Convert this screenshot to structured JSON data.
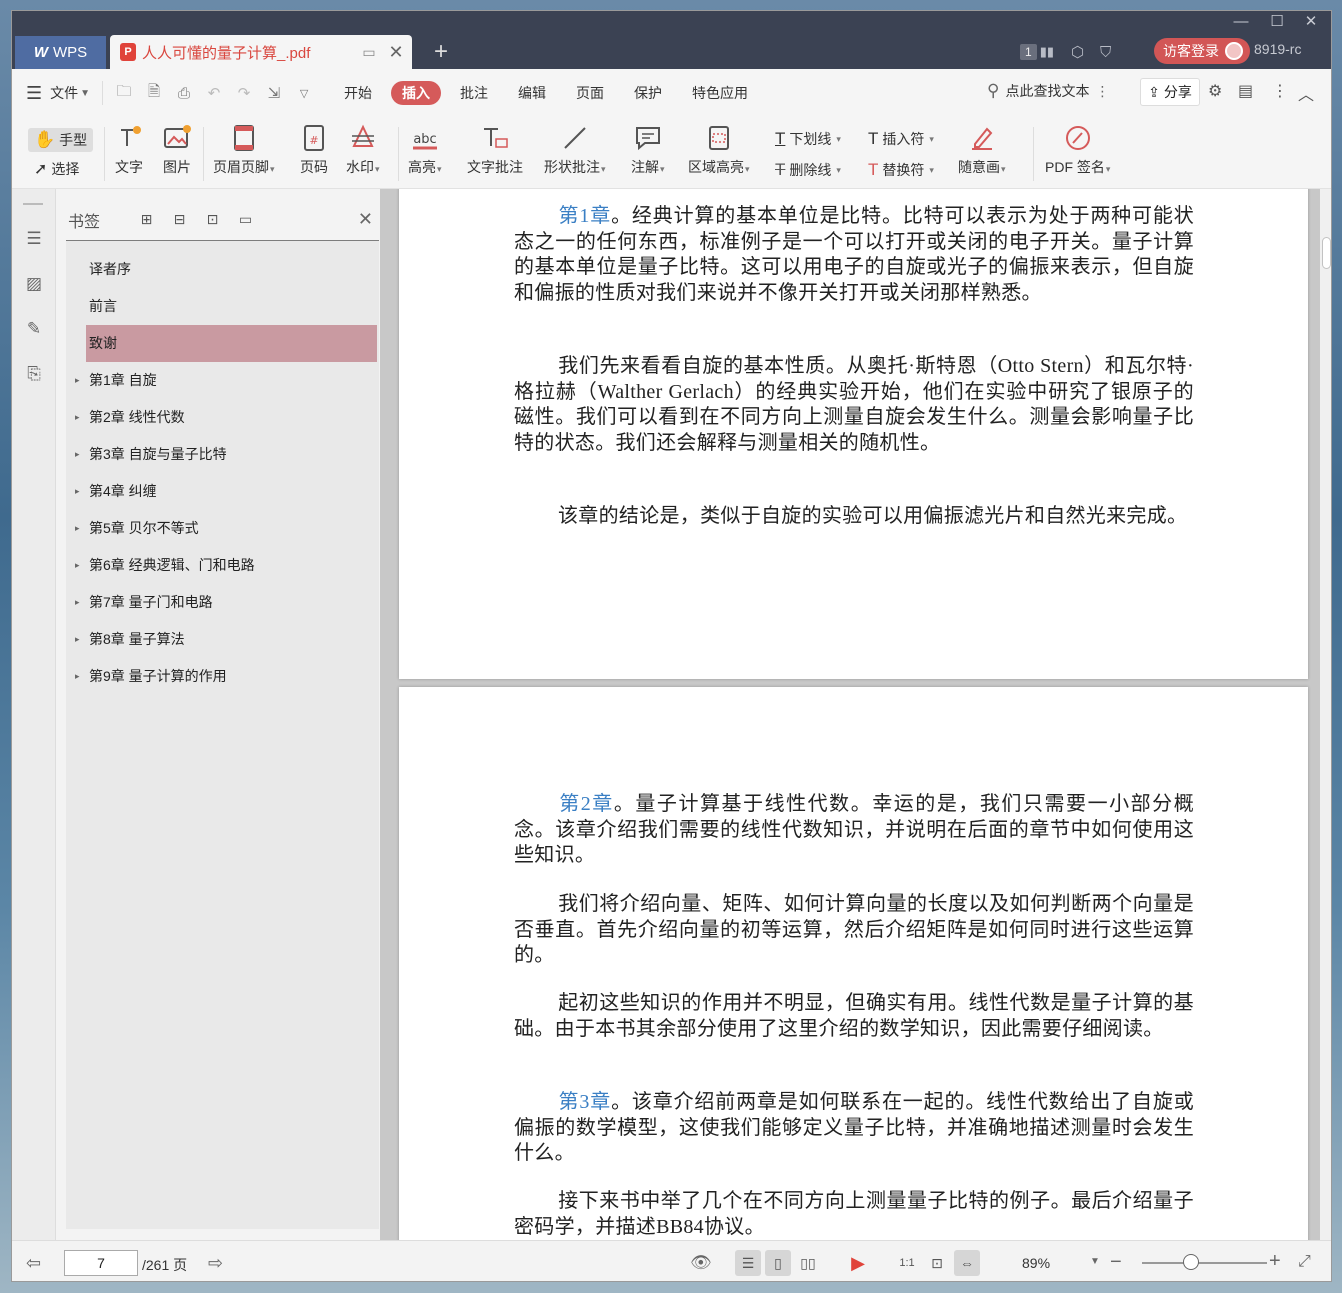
{
  "titlebar": {
    "app_label": "WPS",
    "doc_tab_title": "人人可懂的量子计算_.pdf",
    "page_count_badge": "1",
    "guest_login": "访客登录",
    "user_id": "8919-rc"
  },
  "menu": {
    "file": "文件",
    "items": [
      "开始",
      "插入",
      "批注",
      "编辑",
      "页面",
      "保护",
      "特色应用"
    ],
    "active": "插入",
    "search_label": "点此查找文本",
    "share": "分享"
  },
  "ribbon": {
    "hand": "手型",
    "select": "选择",
    "text": "文字",
    "image": "图片",
    "header_footer": "页眉页脚",
    "page_number": "页码",
    "watermark": "水印",
    "highlight": "高亮",
    "text_note": "文字批注",
    "shape_note": "形状批注",
    "comment": "注解",
    "area_highlight": "区域高亮",
    "underline": "下划线",
    "strikethrough": "删除线",
    "insert_mark": "插入符",
    "replace_mark": "替换符",
    "freehand": "随意画",
    "pdf_sign": "PDF 签名",
    "highlight_icon_text": "abc"
  },
  "bookmarks": {
    "title": "书签",
    "items": [
      {
        "label": "译者序",
        "expandable": false,
        "selected": false
      },
      {
        "label": "前言",
        "expandable": false,
        "selected": false
      },
      {
        "label": "致谢",
        "expandable": false,
        "selected": true
      },
      {
        "label": "第1章 自旋",
        "expandable": true,
        "selected": false
      },
      {
        "label": "第2章 线性代数",
        "expandable": true,
        "selected": false
      },
      {
        "label": "第3章 自旋与量子比特",
        "expandable": true,
        "selected": false
      },
      {
        "label": "第4章 纠缠",
        "expandable": true,
        "selected": false
      },
      {
        "label": "第5章 贝尔不等式",
        "expandable": true,
        "selected": false
      },
      {
        "label": "第6章 经典逻辑、门和电路",
        "expandable": true,
        "selected": false
      },
      {
        "label": "第7章 量子门和电路",
        "expandable": true,
        "selected": false
      },
      {
        "label": "第8章 量子算法",
        "expandable": true,
        "selected": false
      },
      {
        "label": "第9章 量子计算的作用",
        "expandable": true,
        "selected": false
      }
    ]
  },
  "document": {
    "page1": [
      {
        "link": "第1章",
        "text": "。经典计算的基本单位是比特。比特可以表示为处于两种可能状态之一的任何东西，标准例子是一个可以打开或关闭的电子开关。量子计算的基本单位是量子比特。这可以用电子的自旋或光子的偏振来表示，但自旋和偏振的性质对我们来说并不像开关打开或关闭那样熟悉。"
      },
      {
        "link": "",
        "text": "我们先来看看自旋的基本性质。从奥托·斯特恩（Otto Stern）和瓦尔特·格拉赫（Walther Gerlach）的经典实验开始，他们在实验中研究了银原子的磁性。我们可以看到在不同方向上测量自旋会发生什么。测量会影响量子比特的状态。我们还会解释与测量相关的随机性。"
      },
      {
        "link": "",
        "text": "该章的结论是，类似于自旋的实验可以用偏振滤光片和自然光来完成。"
      }
    ],
    "page2": [
      {
        "link": "第2章",
        "text": "。量子计算基于线性代数。幸运的是，我们只需要一小部分概念。该章介绍我们需要的线性代数知识，并说明在后面的章节中如何使用这些知识。"
      },
      {
        "link": "",
        "text": "我们将介绍向量、矩阵、如何计算向量的长度以及如何判断两个向量是否垂直。首先介绍向量的初等运算，然后介绍矩阵是如何同时进行这些运算的。"
      },
      {
        "link": "",
        "text": "起初这些知识的作用并不明显，但确实有用。线性代数是量子计算的基础。由于本书其余部分使用了这里介绍的数学知识，因此需要仔细阅读。"
      },
      {
        "link": "第3章",
        "text": "。该章介绍前两章是如何联系在一起的。线性代数给出了自旋或偏振的数学模型，这使我们能够定义量子比特，并准确地描述测量时会发生什么。"
      },
      {
        "link": "",
        "text": "接下来书中举了几个在不同方向上测量量子比特的例子。最后介绍量子密码学，并描述BB84协议。"
      }
    ]
  },
  "status": {
    "current_page": "7",
    "total_pages": "/261 页",
    "zoom": "89%",
    "zoom_fraction": 0.33
  },
  "colors": {
    "accent": "#d55a5a",
    "link": "#3a7fc4",
    "selected_bookmark": "#c99aa1",
    "titlebar": "#3b4253"
  }
}
